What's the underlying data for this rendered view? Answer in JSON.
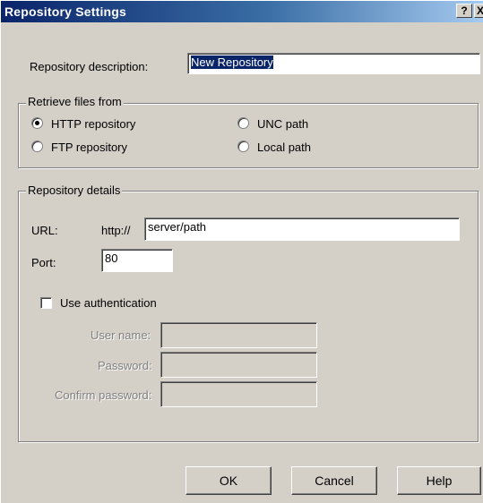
{
  "window": {
    "title": "Repository Settings",
    "help_glyph": "?",
    "close_glyph": "X"
  },
  "description": {
    "label": "Repository description:",
    "value": "New Repository"
  },
  "retrieve_group": {
    "title": "Retrieve files from",
    "options": [
      {
        "label": "HTTP repository",
        "selected": true
      },
      {
        "label": "FTP repository",
        "selected": false
      },
      {
        "label": "UNC path",
        "selected": false
      },
      {
        "label": "Local path",
        "selected": false
      }
    ]
  },
  "details_group": {
    "title": "Repository details",
    "url_label": "URL:",
    "url_prefix": "http://",
    "url_value": "server/path",
    "port_label": "Port:",
    "port_value": "80",
    "use_auth_label": "Use authentication",
    "use_auth_checked": false,
    "username_label": "User name:",
    "username_value": "",
    "password_label": "Password:",
    "password_value": "",
    "confirm_label": "Confirm password:",
    "confirm_value": ""
  },
  "buttons": {
    "ok": "OK",
    "cancel": "Cancel",
    "help": "Help"
  }
}
